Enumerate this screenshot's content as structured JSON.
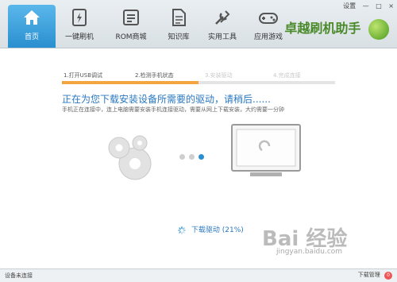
{
  "nav": [
    {
      "label": "首页",
      "icon": "home-icon",
      "active": true
    },
    {
      "label": "一键刷机",
      "icon": "flash-icon",
      "active": false
    },
    {
      "label": "ROM商城",
      "icon": "store-icon",
      "active": false
    },
    {
      "label": "知识库",
      "icon": "document-icon",
      "active": false
    },
    {
      "label": "实用工具",
      "icon": "tools-icon",
      "active": false
    },
    {
      "label": "应用游戏",
      "icon": "games-icon",
      "active": false
    }
  ],
  "system_buttons": [
    "设置",
    "—",
    "□",
    "×"
  ],
  "brand": {
    "text": "卓越刷机助手"
  },
  "steps": [
    {
      "label": "1.打开USB调试",
      "state": "done"
    },
    {
      "label": "2.检测手机状态",
      "state": "current"
    },
    {
      "label": "3.安装驱动",
      "state": "pending"
    },
    {
      "label": "4.完成连接",
      "state": "pending"
    }
  ],
  "step_progress": 0.5,
  "headline": "正在为您下载安装设备所需要的驱动，请稍后......",
  "subtext": "手机正在连接中，连上电脑需要安装手机连接驱动，需要从网上下载安装，大约需要一分钟",
  "loading_dots": {
    "count": 3,
    "active_index": 2
  },
  "status": {
    "label": "下载驱动",
    "percent": "(21%)"
  },
  "bottom": {
    "left": "设备未连接",
    "right": "下载管理",
    "badge": "0"
  },
  "watermark": {
    "text": "Bai 经验",
    "sub": "jingyan.baidu.com"
  },
  "colors": {
    "accent": "#2a8fd0",
    "progress": "#f2a541",
    "headline": "#2a78c2"
  }
}
